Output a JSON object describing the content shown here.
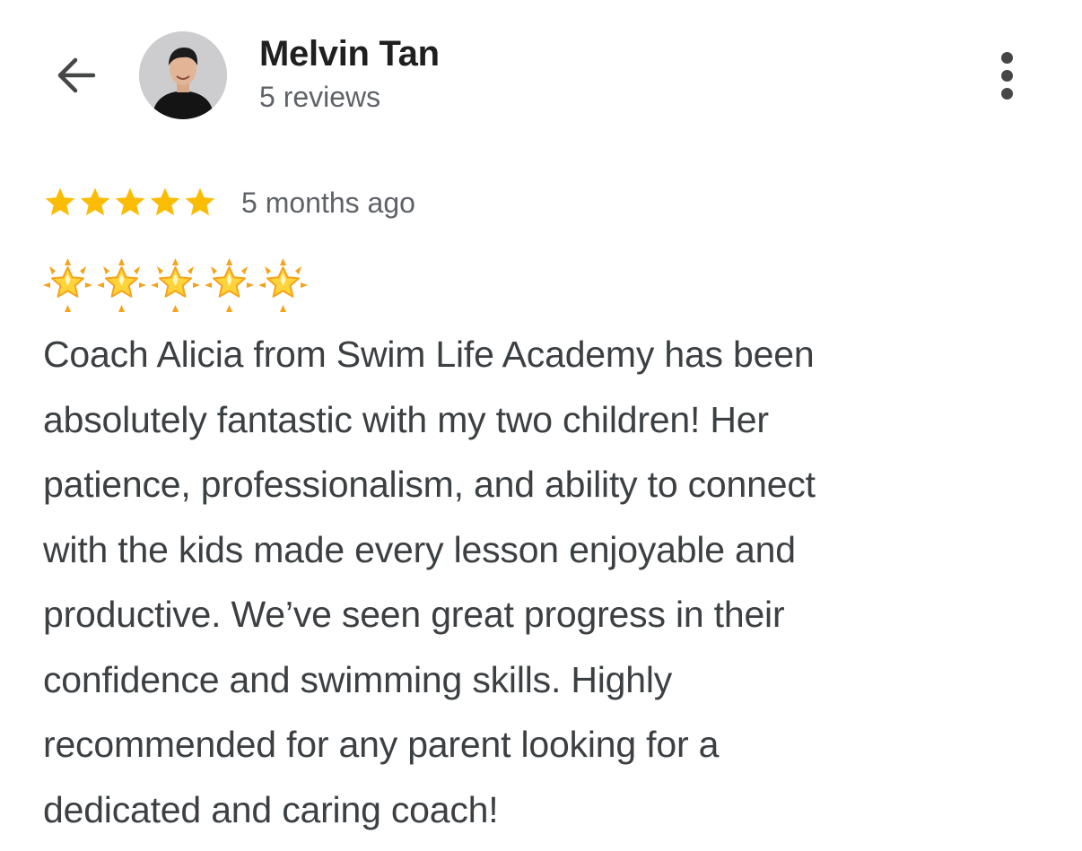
{
  "header": {
    "back_icon": "arrow-left-icon",
    "avatar_icon": "user-avatar",
    "reviewer_name": "Melvin Tan",
    "review_count": "5 reviews",
    "more_icon": "more-vertical-icon"
  },
  "review": {
    "rating": 5,
    "rating_max": 5,
    "star_color": "#fbbc04",
    "time_ago": "5 months ago",
    "emoji": "🌟🌟🌟🌟🌟",
    "lines": [
      "Coach Alicia from Swim Life Academy has been",
      "absolutely fantastic with my two children! Her",
      "patience, professionalism, and ability to connect",
      "with the kids made every lesson enjoyable and",
      "productive. We’ve seen great progress in their",
      "confidence and swimming skills. Highly",
      "recommended for any parent looking for a",
      "dedicated and caring coach!"
    ]
  }
}
